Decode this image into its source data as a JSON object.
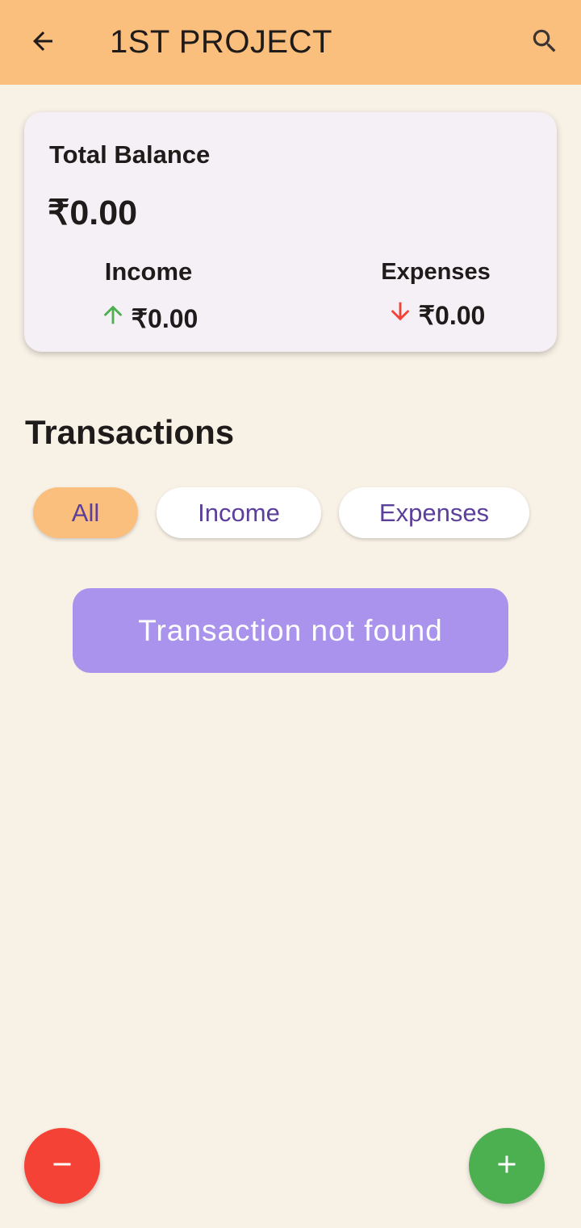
{
  "appbar": {
    "title": "1ST PROJECT",
    "back_icon": "arrow-back-icon",
    "search_icon": "search-icon",
    "background": "#fabf7c"
  },
  "balance_card": {
    "label": "Total Balance",
    "balance": "₹0.00",
    "income": {
      "label": "Income",
      "value": "₹0.00",
      "icon": "arrow-up-icon",
      "color": "#4caf50"
    },
    "expenses": {
      "label": "Expenses",
      "value": "₹0.00",
      "icon": "arrow-down-icon",
      "color": "#f44336"
    }
  },
  "transactions": {
    "title": "Transactions",
    "filters": [
      {
        "label": "All",
        "selected": true
      },
      {
        "label": "Income",
        "selected": false
      },
      {
        "label": "Expenses",
        "selected": false
      }
    ],
    "empty_message": "Transaction not found"
  },
  "fabs": {
    "remove": {
      "icon": "minus-icon",
      "color": "#f44336"
    },
    "add": {
      "icon": "plus-icon",
      "color": "#4caf50"
    }
  }
}
